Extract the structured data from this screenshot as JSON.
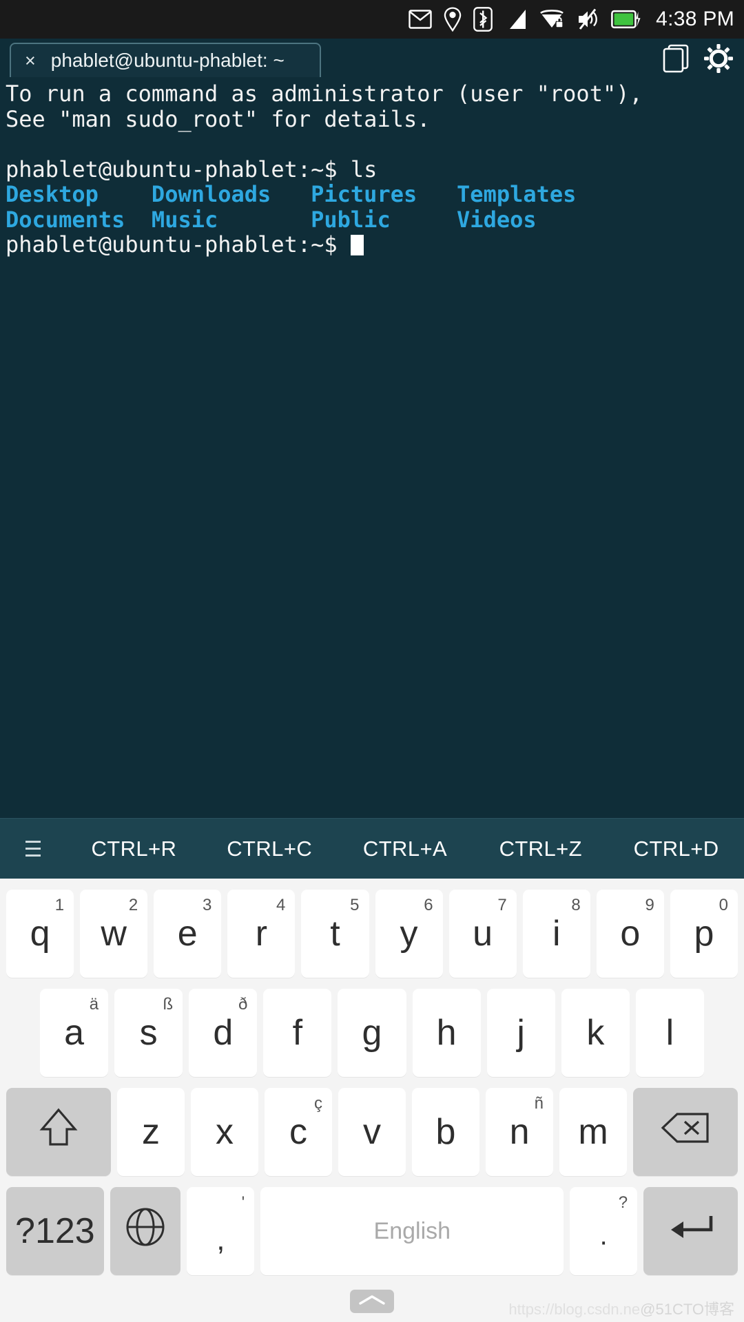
{
  "status_bar": {
    "icons": [
      "mail-icon",
      "location-pin-icon",
      "bluetooth-icon",
      "cellular-signal-icon",
      "wifi-secure-icon",
      "sound-muted-icon",
      "battery-charging-icon"
    ],
    "time": "4:38 PM",
    "background": "#1a1a1a"
  },
  "terminal": {
    "tab": {
      "close_label": "×",
      "title": "phablet@ubuntu-phablet: ~"
    },
    "header_icons": [
      "tabs-icon",
      "settings-gear-icon"
    ],
    "background": "#0f2d38",
    "text_color": "#f2f2f2",
    "dir_color": "#2ea8e0",
    "lines": {
      "l1": "To run a command as administrator (user \"root\"),",
      "l2": "See \"man sudo_root\" for details.",
      "l3": "",
      "prompt1": "phablet@ubuntu-phablet:~$ ls",
      "listing_row1": [
        "Desktop",
        "Downloads",
        "Pictures",
        "Templates"
      ],
      "listing_row2": [
        "Documents",
        "Music",
        "Public",
        "Videos"
      ],
      "prompt2": "phablet@ubuntu-phablet:~$ "
    }
  },
  "ctrl_toolbar": {
    "menu_icon": "hamburger-menu-icon",
    "buttons": [
      "CTRL+R",
      "CTRL+C",
      "CTRL+A",
      "CTRL+Z",
      "CTRL+D"
    ],
    "background": "#1d4450"
  },
  "keyboard": {
    "language_label": "English",
    "symbols_label": "?123",
    "rows": [
      [
        {
          "key": "q",
          "sup": "1"
        },
        {
          "key": "w",
          "sup": "2"
        },
        {
          "key": "e",
          "sup": "3"
        },
        {
          "key": "r",
          "sup": "4"
        },
        {
          "key": "t",
          "sup": "5"
        },
        {
          "key": "y",
          "sup": "6"
        },
        {
          "key": "u",
          "sup": "7"
        },
        {
          "key": "i",
          "sup": "8"
        },
        {
          "key": "o",
          "sup": "9"
        },
        {
          "key": "p",
          "sup": "0"
        }
      ],
      [
        {
          "key": "a",
          "sup": "ä"
        },
        {
          "key": "s",
          "sup": "ß"
        },
        {
          "key": "d",
          "sup": "ð"
        },
        {
          "key": "f",
          "sup": ""
        },
        {
          "key": "g",
          "sup": ""
        },
        {
          "key": "h",
          "sup": ""
        },
        {
          "key": "j",
          "sup": ""
        },
        {
          "key": "k",
          "sup": ""
        },
        {
          "key": "l",
          "sup": ""
        }
      ],
      [
        {
          "key": "z",
          "sup": ""
        },
        {
          "key": "x",
          "sup": ""
        },
        {
          "key": "c",
          "sup": "ç"
        },
        {
          "key": "v",
          "sup": ""
        },
        {
          "key": "b",
          "sup": ""
        },
        {
          "key": "n",
          "sup": "ñ"
        },
        {
          "key": "m",
          "sup": ""
        }
      ]
    ],
    "comma": {
      "key": ",",
      "sup": "'"
    },
    "period": {
      "key": "·",
      "sup": "?"
    },
    "shift_icon": "shift-arrow-icon",
    "backspace_icon": "backspace-icon",
    "globe_icon": "language-globe-icon",
    "enter_icon": "enter-return-icon",
    "drawer_icon": "chevron-up-icon"
  },
  "watermark": {
    "url": "https://blog.csdn.ne",
    "tag": "@51CTO博客"
  }
}
